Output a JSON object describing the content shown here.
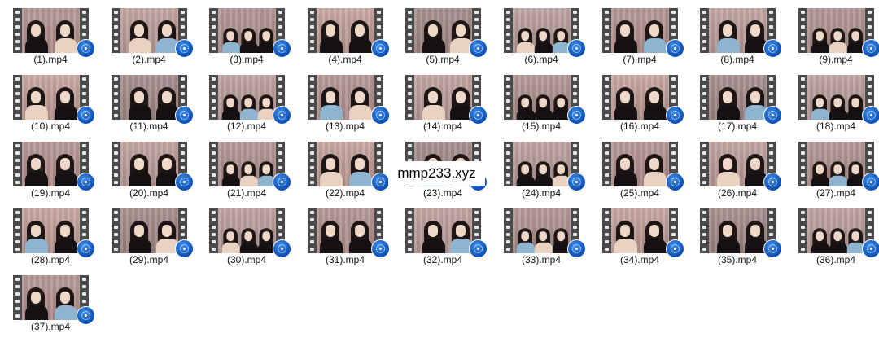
{
  "watermark": "mmp233.xyz",
  "files": [
    {
      "label": "(1).mp4",
      "icon": "video-file-icon"
    },
    {
      "label": "(2).mp4",
      "icon": "video-file-icon"
    },
    {
      "label": "(3).mp4",
      "icon": "video-file-icon"
    },
    {
      "label": "(4).mp4",
      "icon": "video-file-icon"
    },
    {
      "label": "(5).mp4",
      "icon": "video-file-icon"
    },
    {
      "label": "(6).mp4",
      "icon": "video-file-icon"
    },
    {
      "label": "(7).mp4",
      "icon": "video-file-icon"
    },
    {
      "label": "(8).mp4",
      "icon": "video-file-icon"
    },
    {
      "label": "(9).mp4",
      "icon": "video-file-icon"
    },
    {
      "label": "(10).mp4",
      "icon": "video-file-icon"
    },
    {
      "label": "(11).mp4",
      "icon": "video-file-icon"
    },
    {
      "label": "(12).mp4",
      "icon": "video-file-icon"
    },
    {
      "label": "(13).mp4",
      "icon": "video-file-icon"
    },
    {
      "label": "(14).mp4",
      "icon": "video-file-icon"
    },
    {
      "label": "(15).mp4",
      "icon": "video-file-icon"
    },
    {
      "label": "(16).mp4",
      "icon": "video-file-icon"
    },
    {
      "label": "(17).mp4",
      "icon": "video-file-icon"
    },
    {
      "label": "(18).mp4",
      "icon": "video-file-icon"
    },
    {
      "label": "(19).mp4",
      "icon": "video-file-icon"
    },
    {
      "label": "(20).mp4",
      "icon": "video-file-icon"
    },
    {
      "label": "(21).mp4",
      "icon": "video-file-icon"
    },
    {
      "label": "(22).mp4",
      "icon": "video-file-icon"
    },
    {
      "label": "(23).mp4",
      "icon": "video-file-icon"
    },
    {
      "label": "(24).mp4",
      "icon": "video-file-icon"
    },
    {
      "label": "(25).mp4",
      "icon": "video-file-icon"
    },
    {
      "label": "(26).mp4",
      "icon": "video-file-icon"
    },
    {
      "label": "(27).mp4",
      "icon": "video-file-icon"
    },
    {
      "label": "(28).mp4",
      "icon": "video-file-icon"
    },
    {
      "label": "(29).mp4",
      "icon": "video-file-icon"
    },
    {
      "label": "(30).mp4",
      "icon": "video-file-icon"
    },
    {
      "label": "(31).mp4",
      "icon": "video-file-icon"
    },
    {
      "label": "(32).mp4",
      "icon": "video-file-icon"
    },
    {
      "label": "(33).mp4",
      "icon": "video-file-icon"
    },
    {
      "label": "(34).mp4",
      "icon": "video-file-icon"
    },
    {
      "label": "(35).mp4",
      "icon": "video-file-icon"
    },
    {
      "label": "(36).mp4",
      "icon": "video-file-icon"
    },
    {
      "label": "(37).mp4",
      "icon": "video-file-icon"
    }
  ],
  "colors": {
    "badge_accent": "#1565c0",
    "film_strip": "#4a4a4a",
    "label_text": "#111111"
  }
}
